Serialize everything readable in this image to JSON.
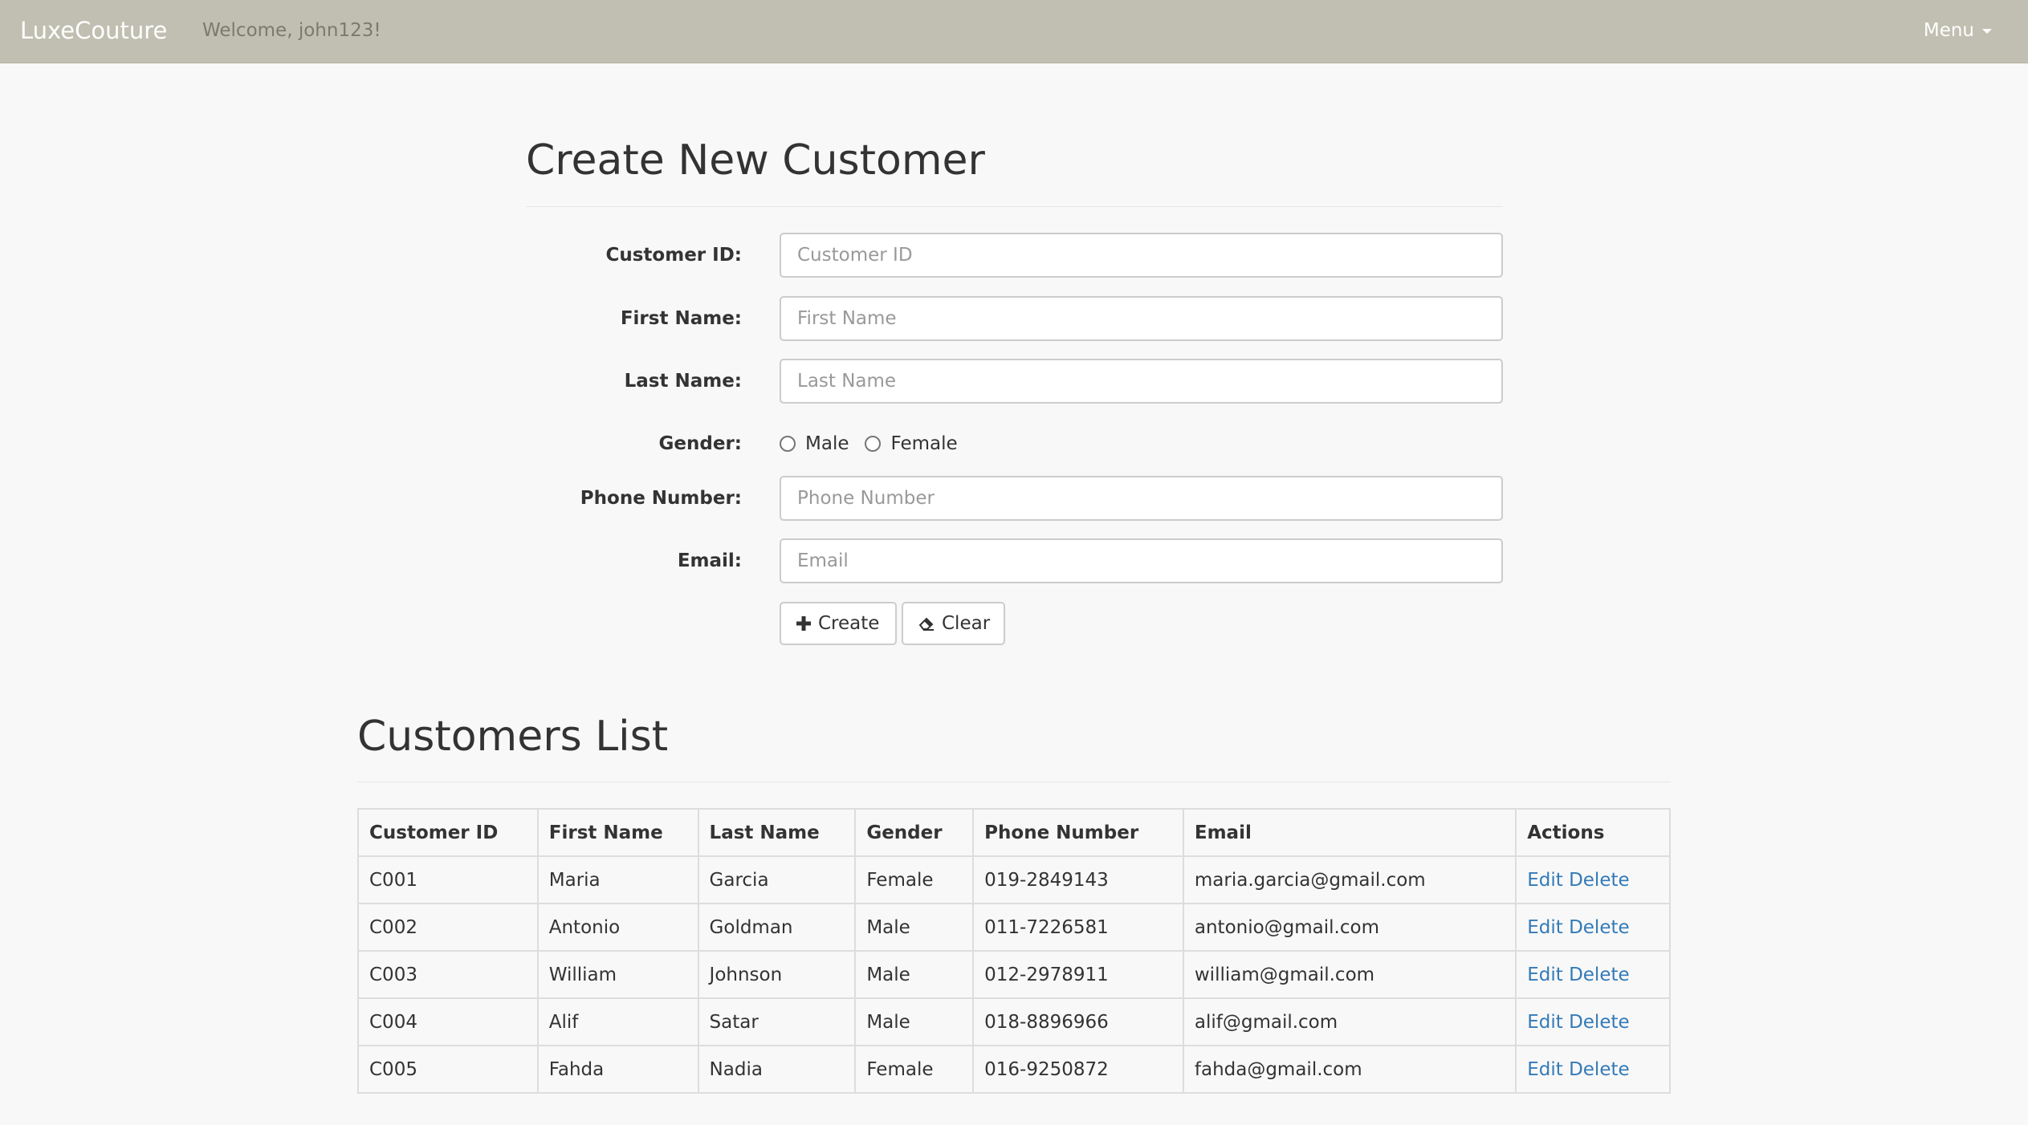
{
  "navbar": {
    "brand": "LuxeCouture",
    "welcome": "Welcome, john123!",
    "menu_label": "Menu"
  },
  "form": {
    "heading": "Create New Customer",
    "fields": {
      "customer_id": {
        "label": "Customer ID:",
        "placeholder": "Customer ID",
        "value": ""
      },
      "first_name": {
        "label": "First Name:",
        "placeholder": "First Name",
        "value": ""
      },
      "last_name": {
        "label": "Last Name:",
        "placeholder": "Last Name",
        "value": ""
      },
      "gender": {
        "label": "Gender:",
        "options": [
          "Male",
          "Female"
        ],
        "selected": null
      },
      "phone": {
        "label": "Phone Number:",
        "placeholder": "Phone Number",
        "value": ""
      },
      "email": {
        "label": "Email:",
        "placeholder": "Email",
        "value": ""
      }
    },
    "buttons": {
      "create": "Create",
      "clear": "Clear"
    }
  },
  "list": {
    "heading": "Customers List",
    "columns": [
      "Customer ID",
      "First Name",
      "Last Name",
      "Gender",
      "Phone Number",
      "Email",
      "Actions"
    ],
    "rows": [
      {
        "id": "C001",
        "first": "Maria",
        "last": "Garcia",
        "gender": "Female",
        "phone": "019-2849143",
        "email": "maria.garcia@gmail.com"
      },
      {
        "id": "C002",
        "first": "Antonio",
        "last": "Goldman",
        "gender": "Male",
        "phone": "011-7226581",
        "email": "antonio@gmail.com"
      },
      {
        "id": "C003",
        "first": "William",
        "last": "Johnson",
        "gender": "Male",
        "phone": "012-2978911",
        "email": "william@gmail.com"
      },
      {
        "id": "C004",
        "first": "Alif",
        "last": "Satar",
        "gender": "Male",
        "phone": "018-8896966",
        "email": "alif@gmail.com"
      },
      {
        "id": "C005",
        "first": "Fahda",
        "last": "Nadia",
        "gender": "Female",
        "phone": "016-9250872",
        "email": "fahda@gmail.com"
      }
    ],
    "actions": {
      "edit": "Edit",
      "delete": "Delete"
    }
  },
  "colors": {
    "navbar_bg": "#c0bfb1",
    "link": "#337ab7",
    "page_bg": "#f8f8f8"
  },
  "icons": {
    "create": "plus-icon",
    "clear": "eraser-icon",
    "menu": "caret-down-icon"
  }
}
